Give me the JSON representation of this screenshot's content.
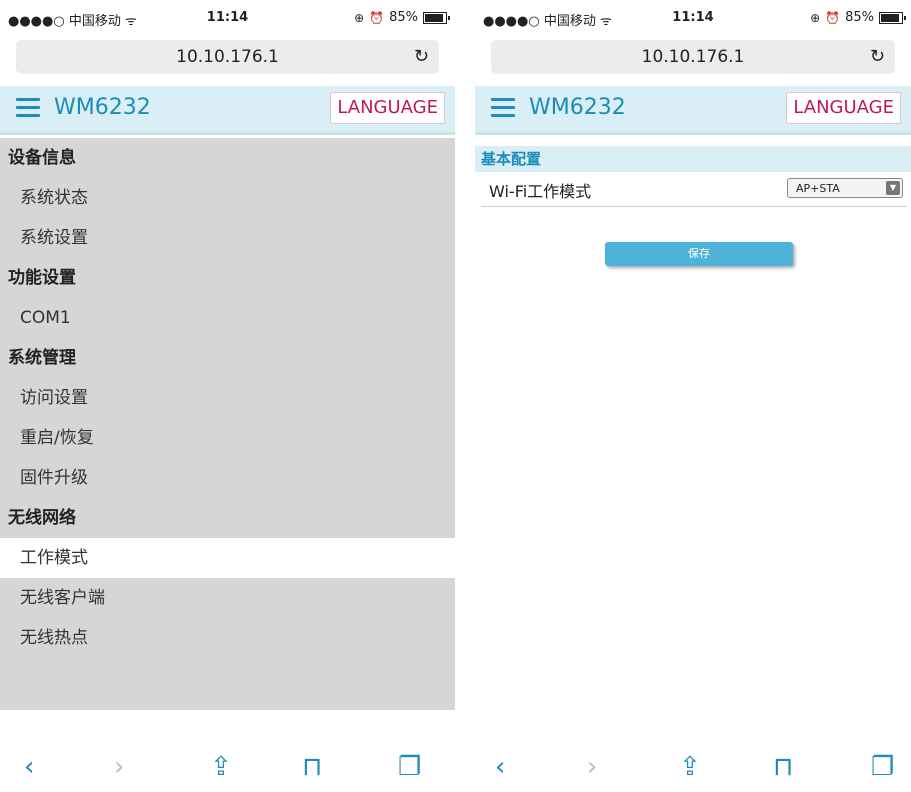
{
  "left": {
    "status_bar": {
      "carrier": "●●●●○ 中国移动 ᯤ",
      "time": "11:14",
      "battery": "85%"
    },
    "browser": {
      "url": "10.10.176.1"
    },
    "header": {
      "brand": "WM6232",
      "language_button": "LANGUAGE"
    },
    "nav": {
      "sections": [
        {
          "title": "设备信息",
          "items": [
            "系统状态",
            "系统设置"
          ]
        },
        {
          "title": "功能设置",
          "items": [
            "COM1"
          ]
        },
        {
          "title": "系统管理",
          "items": [
            "访问设置",
            "重启/恢复",
            "固件升级"
          ]
        },
        {
          "title": "无线网络",
          "items": [
            "工作模式",
            "无线客户端",
            "无线热点"
          ]
        }
      ],
      "active_item": "工作模式"
    }
  },
  "right": {
    "status_bar": {
      "carrier": "●●●●○ 中国移动 ᯤ",
      "time": "11:14",
      "battery": "85%"
    },
    "browser": {
      "url": "10.10.176.1"
    },
    "header": {
      "brand": "WM6232",
      "language_button": "LANGUAGE"
    },
    "config": {
      "section_title": "基本配置",
      "label": "Wi-Fi工作模式",
      "mode_value": "AP+STA",
      "save_label": "保存"
    }
  },
  "bottom_bar_icons": [
    "back-icon",
    "forward-icon",
    "share-icon",
    "bookmarks-icon",
    "tabs-icon"
  ],
  "colors": {
    "accent": "#1e8bb8",
    "language": "#c2185b",
    "nav_bg": "#d6d6d6",
    "header_bg": "#d9eef5"
  }
}
